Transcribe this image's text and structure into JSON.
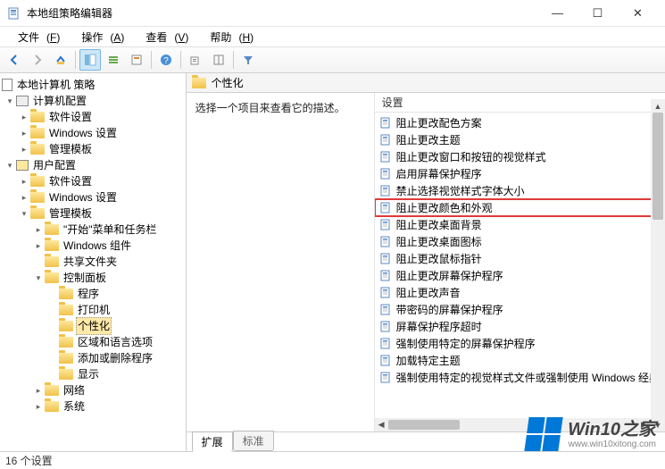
{
  "window": {
    "title": "本地组策略编辑器"
  },
  "menubar": {
    "file": {
      "label": "文件",
      "key": "F"
    },
    "action": {
      "label": "操作",
      "key": "A"
    },
    "view": {
      "label": "查看",
      "key": "V"
    },
    "help": {
      "label": "帮助",
      "key": "H"
    }
  },
  "toolbar": {
    "icons": [
      "back-icon",
      "forward-icon",
      "up-icon",
      "tree-toggle-icon",
      "list-icon",
      "details-icon",
      "help-icon",
      "export-icon",
      "filter-icon"
    ]
  },
  "tree": {
    "root": "本地计算机 策略",
    "computer_cfg": "计算机配置",
    "software_settings": "软件设置",
    "windows_settings": "Windows 设置",
    "admin_templates": "管理模板",
    "user_cfg": "用户配置",
    "user_software_settings": "软件设置",
    "user_windows_settings": "Windows 设置",
    "user_admin_templates": "管理模板",
    "start_taskbar": "\"开始\"菜单和任务栏",
    "windows_components": "Windows 组件",
    "shared_folders": "共享文件夹",
    "control_panel": "控制面板",
    "cp_programs": "程序",
    "cp_printers": "打印机",
    "cp_personalization": "个性化",
    "cp_region_lang": "区域和语言选项",
    "cp_add_remove": "添加或删除程序",
    "cp_display": "显示",
    "network": "网络",
    "system": "系统"
  },
  "right": {
    "header": "个性化",
    "desc_prompt": "选择一个项目来查看它的描述。",
    "col_setting": "设置",
    "tabs": {
      "extended": "扩展",
      "standard": "标准"
    }
  },
  "settings": [
    "阻止更改配色方案",
    "阻止更改主题",
    "阻止更改窗口和按钮的视觉样式",
    "启用屏幕保护程序",
    "禁止选择视觉样式字体大小",
    "阻止更改颜色和外观",
    "阻止更改桌面背景",
    "阻止更改桌面图标",
    "阻止更改鼠标指针",
    "阻止更改屏幕保护程序",
    "阻止更改声音",
    "带密码的屏幕保护程序",
    "屏幕保护程序超时",
    "强制使用特定的屏幕保护程序",
    "加载特定主题",
    "强制使用特定的视觉样式文件或强制使用 Windows 经典"
  ],
  "highlighted_index": 5,
  "status": {
    "count_label": "16 个设置"
  },
  "watermark": {
    "brand": "Win10之家",
    "url": "www.win10xitong.com"
  }
}
